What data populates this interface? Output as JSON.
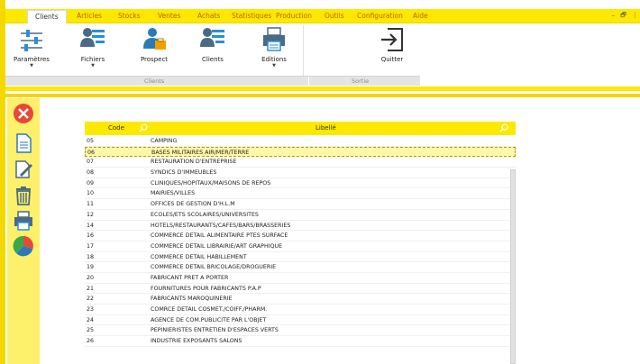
{
  "tabs": [
    {
      "label": "Clients",
      "active": true
    },
    {
      "label": "Articles",
      "active": false
    },
    {
      "label": "Stocks",
      "active": false
    },
    {
      "label": "Ventes",
      "active": false
    },
    {
      "label": "Achats",
      "active": false
    },
    {
      "label": "Statistiques",
      "active": false
    },
    {
      "label": "Production",
      "active": false
    },
    {
      "label": "Outils",
      "active": false
    },
    {
      "label": "Configuration",
      "active": false
    },
    {
      "label": "Aide",
      "active": false
    }
  ],
  "window_controls": {
    "minimize": "–",
    "restore": "🗗",
    "close": "⋮"
  },
  "ribbon": {
    "buttons": [
      {
        "label": "Paramètres",
        "icon": "sliders-icon",
        "dropdown": "▼"
      },
      {
        "label": "Fichiers",
        "icon": "users-list-icon",
        "dropdown": "▼"
      },
      {
        "label": "Prospect",
        "icon": "prospect-icon"
      },
      {
        "label": "Clients",
        "icon": "clients-icon"
      },
      {
        "label": "Editions",
        "icon": "printer-icon",
        "dropdown": "▼"
      },
      {
        "label": "Quitter",
        "icon": "exit-icon"
      }
    ],
    "groups": {
      "clients": "Clients",
      "sortie": "Sortie"
    }
  },
  "sidebar_icons": [
    "delete-icon",
    "document-icon",
    "edit-icon",
    "trash-icon",
    "print-icon",
    "pie-chart-icon"
  ],
  "grid": {
    "columns": {
      "code": "Code",
      "libelle": "Libellé"
    },
    "rows": [
      {
        "code": "05",
        "libelle": "CAMPING"
      },
      {
        "code": "06",
        "libelle": "BASES MILITAIRES AIR/MER/TERRE",
        "selected": true
      },
      {
        "code": "07",
        "libelle": "RESTAURATION D'ENTREPRISE"
      },
      {
        "code": "08",
        "libelle": "SYNDICS D'IMMEUBLES"
      },
      {
        "code": "09",
        "libelle": "CLINIQUES/HOPITAUX/MAISONS DE REPOS"
      },
      {
        "code": "10",
        "libelle": "MAIRIES/VILLES"
      },
      {
        "code": "11",
        "libelle": "OFFICES DE GESTION D'H.L.M"
      },
      {
        "code": "12",
        "libelle": "ECOLES/ETS SCOLAIRES/UNIVERSITES"
      },
      {
        "code": "14",
        "libelle": "HOTELS/RESTAURANTS/CAFES/BARS/BRASSERIES"
      },
      {
        "code": "16",
        "libelle": "COMMERCE DETAIL ALIMENTAIRE PTES SURFACE"
      },
      {
        "code": "17",
        "libelle": "COMMERCE DETAIL LIBRAIRIE/ART GRAPHIQUE"
      },
      {
        "code": "18",
        "libelle": "COMMERCE DETAIL HABILLEMENT"
      },
      {
        "code": "19",
        "libelle": "COMMERCE DETAIL BRICOLAGE/DROGUERIE"
      },
      {
        "code": "20",
        "libelle": "FABRICANT PRET A PORTER"
      },
      {
        "code": "21",
        "libelle": "FOURNITURES POUR FABRICANTS P.A.P"
      },
      {
        "code": "22",
        "libelle": "FABRICANTS MAROQUINERIE"
      },
      {
        "code": "23",
        "libelle": "COMRCE DETAIL COSMET./COIFF./PHARM."
      },
      {
        "code": "24",
        "libelle": "AGENCE DE COM.PUBLICITE PAR L'OBJET"
      },
      {
        "code": "25",
        "libelle": "PEPINIERISTES ENTRETIEN D'ESPACES VERTS"
      },
      {
        "code": "26",
        "libelle": "INDUSTRIE EXPOSANTS SALONS"
      }
    ]
  },
  "colors": {
    "accent_yellow": "#fde800",
    "selection": "#fff7a8",
    "tab_text": "#b8640a"
  }
}
